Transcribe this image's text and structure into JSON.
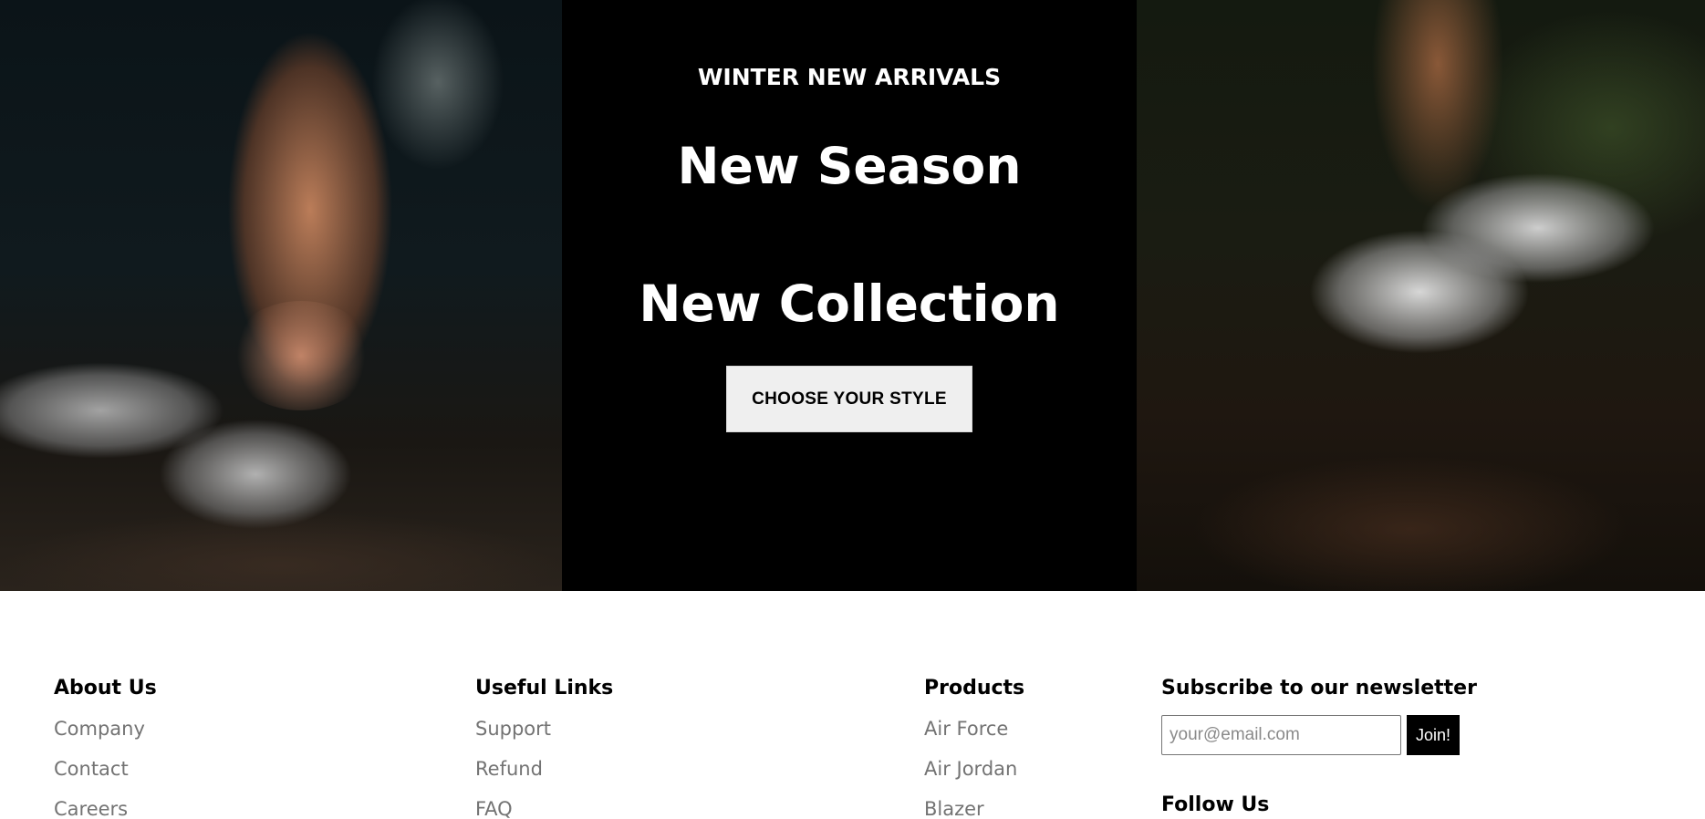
{
  "hero": {
    "eyebrow": "WINTER NEW ARRIVALS",
    "headline_line1": "New Season",
    "headline_line2": "New Collection",
    "cta_label": "CHOOSE YOUR STYLE"
  },
  "footer": {
    "about": {
      "heading": "About Us",
      "links": [
        "Company",
        "Contact",
        "Careers"
      ]
    },
    "useful": {
      "heading": "Useful Links",
      "links": [
        "Support",
        "Refund",
        "FAQ"
      ]
    },
    "products": {
      "heading": "Products",
      "links": [
        "Air Force",
        "Air Jordan",
        "Blazer"
      ]
    },
    "newsletter": {
      "heading": "Subscribe to our newsletter",
      "email_placeholder": "your@email.com",
      "email_value": "",
      "join_label": "Join!",
      "follow_heading": "Follow Us"
    }
  },
  "colors": {
    "hero_center_bg": "#000000",
    "cta_bg": "#efefef",
    "link_gray": "#737373",
    "join_bg": "#000000"
  }
}
